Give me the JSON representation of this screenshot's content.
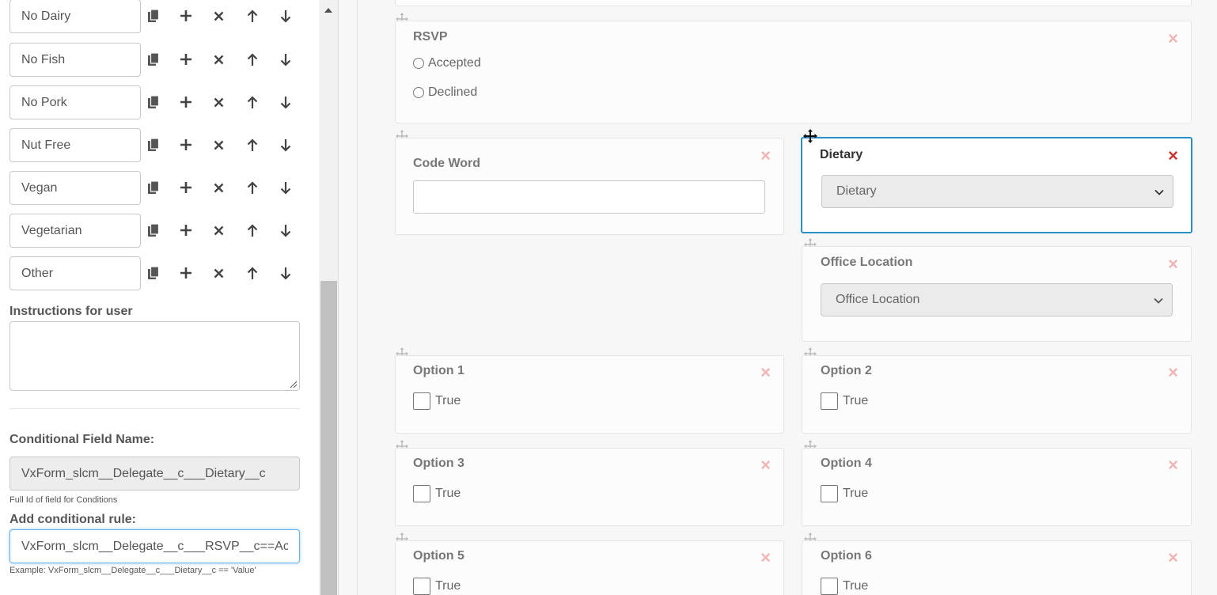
{
  "option_list": [
    {
      "label": "No Dairy"
    },
    {
      "label": "No Fish"
    },
    {
      "label": "No Pork"
    },
    {
      "label": "Nut Free"
    },
    {
      "label": "Vegan"
    },
    {
      "label": "Vegetarian"
    },
    {
      "label": "Other"
    }
  ],
  "settings": {
    "instructions_label": "Instructions for user",
    "instructions_value": "",
    "conditional_field_name_label": "Conditional Field Name:",
    "conditional_field_name_value": "VxForm_slcm__Delegate__c___Dietary__c",
    "conditional_field_help": "Full Id of field for Conditions",
    "add_rule_label": "Add conditional rule:",
    "add_rule_value": "VxForm_slcm__Delegate__c___RSVP__c==Accepted",
    "add_rule_help": "Example: VxForm_slcm__Delegate__c___Dietary__c == 'Value'"
  },
  "canvas": {
    "rsvp": {
      "title": "RSVP",
      "options": [
        "Accepted",
        "Declined"
      ]
    },
    "code_word": {
      "title": "Code Word",
      "value": ""
    },
    "dietary": {
      "title": "Dietary",
      "selected": "Dietary"
    },
    "office_location": {
      "title": "Office Location",
      "selected": "Office Location"
    },
    "options": [
      {
        "title": "Option 1",
        "checkbox_label": "True"
      },
      {
        "title": "Option 2",
        "checkbox_label": "True"
      },
      {
        "title": "Option 3",
        "checkbox_label": "True"
      },
      {
        "title": "Option 4",
        "checkbox_label": "True"
      },
      {
        "title": "Option 5",
        "checkbox_label": "True"
      },
      {
        "title": "Option 6",
        "checkbox_label": "True"
      }
    ],
    "close_glyph": "×"
  },
  "colors": {
    "selected_border": "#2a8fc4",
    "close_active": "#c9302c",
    "close_inactive": "#f0b4b4"
  }
}
